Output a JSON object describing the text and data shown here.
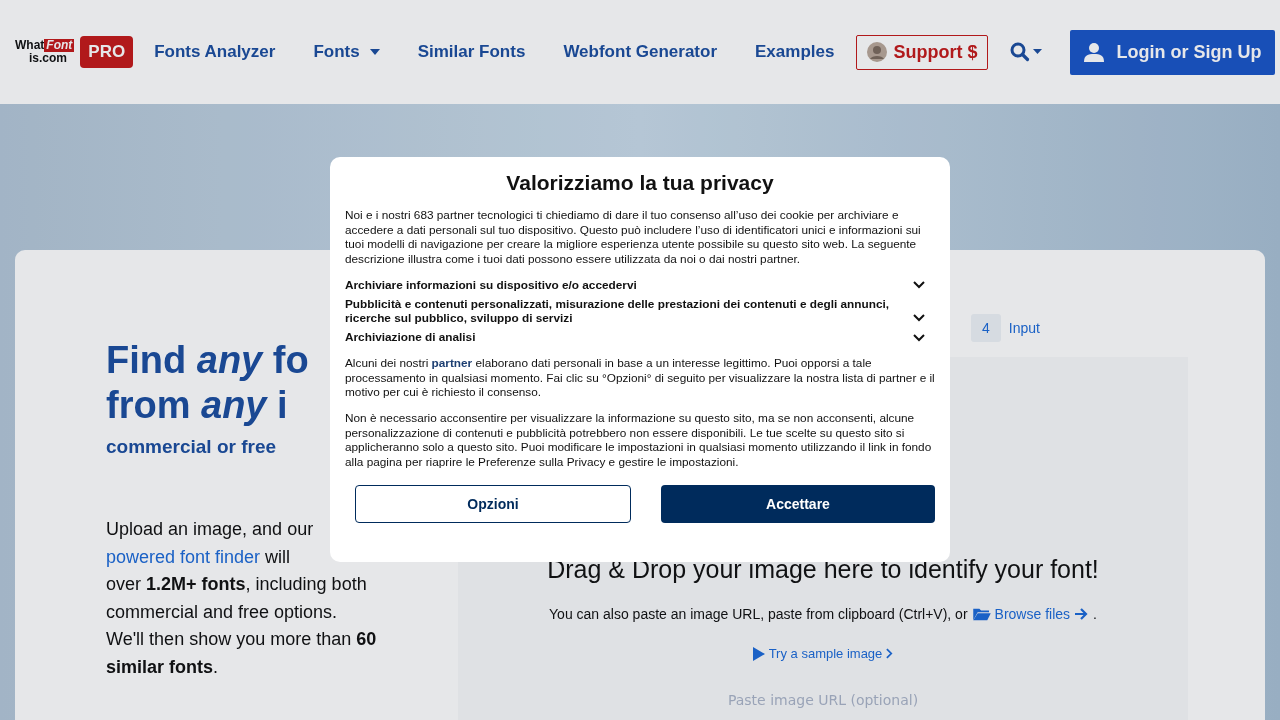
{
  "nav": {
    "logo": {
      "word_1": "What",
      "word_2": "Font",
      "word_3": "is.com"
    },
    "pro_badge": "PRO",
    "links": [
      {
        "label": "Fonts Analyzer",
        "dropdown": false
      },
      {
        "label": "Fonts",
        "dropdown": true
      },
      {
        "label": "Similar Fonts",
        "dropdown": false
      },
      {
        "label": "Webfont Generator",
        "dropdown": false
      },
      {
        "label": "Examples",
        "dropdown": false
      }
    ],
    "support_button": "Support $",
    "login_button": "Login or Sign Up"
  },
  "hero": {
    "heading": "Find *any* fo\nfrom *any* i",
    "subtitle": "commercial or free",
    "description": {
      "before": "Upload an image, and our",
      "link": "powered font finder",
      "after": " will\nover **1.2M+ fonts**, including both\ncommercial and free options.\nWe'll then show you more than **60**\n**similar fonts**."
    }
  },
  "steps": [
    {
      "number": "4",
      "label": "Input"
    }
  ],
  "upload": {
    "drop_text": "Drag & Drop your image here to identify your font!",
    "hint": "You can also paste an image URL, paste from clipboard (Ctrl+V), or",
    "browse_link": "Browse files",
    "hint_end": ".",
    "sample_link": "Try a sample image",
    "url_field": {
      "placeholder": "Paste image URL (optional)"
    }
  },
  "consent": {
    "title": "Valorizziamo la tua privacy",
    "intro": "Noi e i nostri 683 partner tecnologici ti chiediamo di dare il tuo consenso all’uso dei cookie per archiviare e accedere a dati personali sul tuo dispositivo. Questo può includere l’uso di identificatori unici e informazioni sui tuoi modelli di navigazione per creare la migliore esperienza utente possibile su questo sito web. La seguente descrizione illustra come i tuoi dati possono essere utilizzata da noi o dai nostri partner.",
    "purposes": [
      {
        "label": "Archiviare informazioni su dispositivo e/o accedervi",
        "expanded": false
      },
      {
        "label": "Pubblicità e contenuti personalizzati, misurazione delle prestazioni dei contenuti e degli annunci, ricerche sul pubblico, sviluppo di servizi",
        "expanded": false
      },
      {
        "label": "Archiviazione di analisi",
        "expanded": false
      }
    ],
    "legit": {
      "before": "Alcuni dei nostri",
      "link": "partner",
      "after": "elaborano dati personali in base a un interesse legittimo. Puoi opporsi a tale processamento in qualsiasi momento. Fai clic su °Opzioni° di seguito per visualizzare la nostra lista di partner e il motivo per cui è richiesto il consenso."
    },
    "notice": "Non è necessario acconsentire per visualizzare la informazione su questo sito, ma se non acconsenti, alcune personalizzazione di contenuti e pubblicità potrebbero non essere disponibili. Le tue scelte su questo sito si applicheranno solo a questo sito. Puoi modificare le impostazioni in qualsiasi momento utilizzando il link in fondo alla pagina per riaprire le Preferenze sulla Privacy e gestire le impostazioni.",
    "buttons": [
      {
        "label": "Opzioni",
        "kind": "secondary"
      },
      {
        "label": "Accettare",
        "kind": "primary"
      }
    ]
  }
}
